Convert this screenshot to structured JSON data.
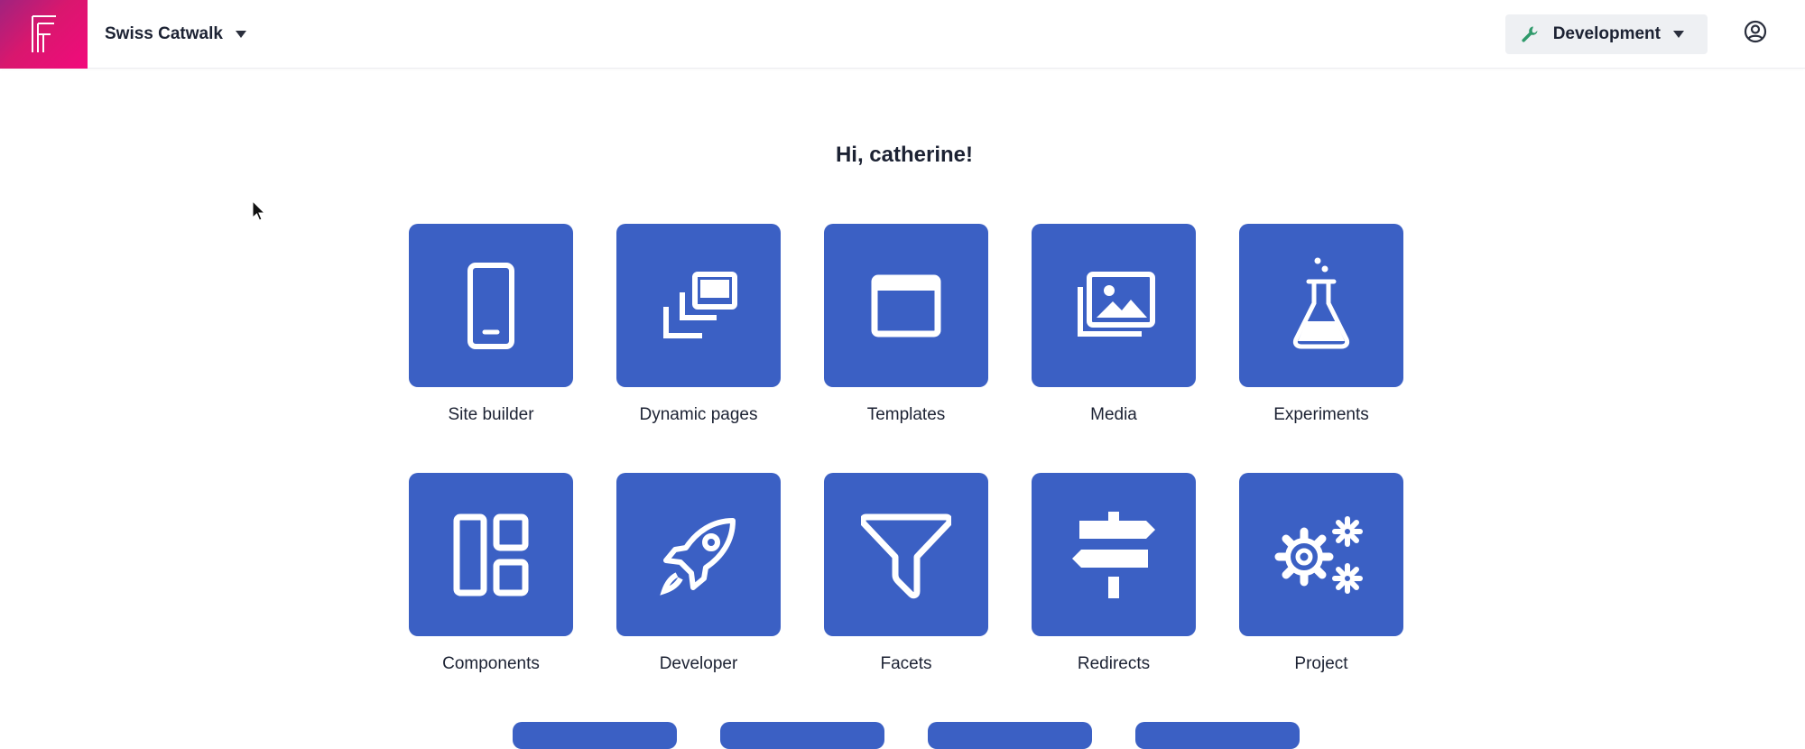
{
  "header": {
    "project_name": "Swiss Catwalk",
    "environment": "Development",
    "brand_color": "#e1127a",
    "env_icon_color": "#2f9a6b"
  },
  "main": {
    "greeting": "Hi, catherine!",
    "tile_color": "#3b60c4",
    "tiles": [
      {
        "label": "Site builder",
        "icon": "mobile-phone-icon"
      },
      {
        "label": "Dynamic pages",
        "icon": "stacked-windows-icon"
      },
      {
        "label": "Templates",
        "icon": "window-icon"
      },
      {
        "label": "Media",
        "icon": "images-icon"
      },
      {
        "label": "Experiments",
        "icon": "flask-icon"
      },
      {
        "label": "Components",
        "icon": "layout-blocks-icon"
      },
      {
        "label": "Developer",
        "icon": "rocket-icon"
      },
      {
        "label": "Facets",
        "icon": "filter-funnel-icon"
      },
      {
        "label": "Redirects",
        "icon": "signpost-icon"
      },
      {
        "label": "Project",
        "icon": "gears-icon"
      }
    ]
  }
}
